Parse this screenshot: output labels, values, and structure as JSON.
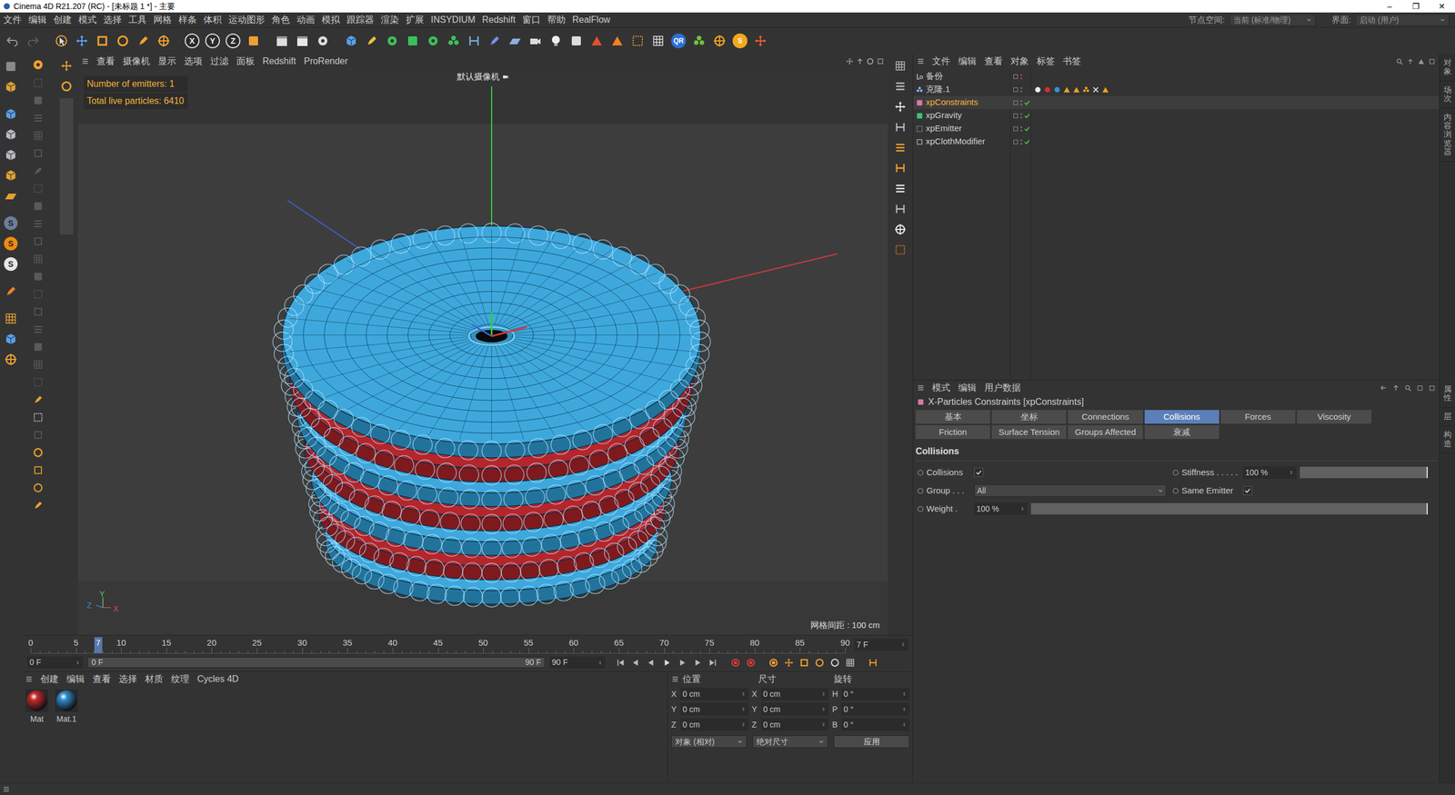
{
  "window": {
    "title": "Cinema 4D R21.207 (RC) - [未标题 1 *] - 主要",
    "controls": [
      "–",
      "❐",
      "✕"
    ]
  },
  "menubar": {
    "items": [
      "文件",
      "编辑",
      "创建",
      "模式",
      "选择",
      "工具",
      "网格",
      "样条",
      "体积",
      "运动图形",
      "角色",
      "动画",
      "模拟",
      "跟踪器",
      "渲染",
      "扩展",
      "INSYDIUM",
      "Redshift",
      "窗口",
      "帮助",
      "RealFlow"
    ],
    "node_space": {
      "label": "节点空间:",
      "value": "当前 (标准/物理)"
    },
    "layout": {
      "label": "界面:",
      "value": "启动 (用户)"
    }
  },
  "toolbar": {
    "axis_keys": [
      "X",
      "Y",
      "Z"
    ],
    "plugins": [
      {
        "label": "QR",
        "color": "#2d6fd6"
      },
      {
        "label": "S",
        "color": "#f2a81d"
      }
    ]
  },
  "left_toolbar": {
    "badges": [
      {
        "label": "S",
        "color": "#6a7f9c"
      },
      {
        "label": "S",
        "color": "#ee8a14"
      },
      {
        "label": "S",
        "color": "#e6e6e6"
      }
    ]
  },
  "viewport": {
    "menu": [
      "查看",
      "摄像机",
      "显示",
      "选项",
      "过滤",
      "面板",
      "Redshift",
      "ProRender"
    ],
    "camera": "默认摄像机",
    "hud": [
      "Number of emitters: 1",
      "Total live particles: 6410"
    ],
    "grid_spacing": "网格间距 : 100 cm",
    "gizmo": [
      {
        "label": "Z",
        "color": "#4a78d8"
      },
      {
        "label": "Y",
        "color": "#5cc85c"
      },
      {
        "label": "X",
        "color": "#d84a4a"
      }
    ]
  },
  "timeline": {
    "ticks": [
      "0",
      "5",
      "10",
      "15",
      "20",
      "25",
      "30",
      "35",
      "40",
      "45",
      "50",
      "55",
      "60",
      "65",
      "70",
      "75",
      "80",
      "85",
      "90"
    ],
    "current_label": "7",
    "current_level": 0.078,
    "current_field": "7 F",
    "start_field": "0 F",
    "range_start": "0 F",
    "range_end": "90 F",
    "end_field": "90 F"
  },
  "materials": {
    "menu": [
      "创建",
      "编辑",
      "查看",
      "选择",
      "材质",
      "纹理",
      "Cycles 4D"
    ],
    "items": [
      {
        "name": "Mat",
        "color": "#c42a2a",
        "selected": false
      },
      {
        "name": "Mat.1",
        "color": "#2e8ccc",
        "selected": false
      }
    ]
  },
  "coordinates": {
    "headers": [
      "位置",
      "尺寸",
      "旋转"
    ],
    "rows": [
      {
        "position": {
          "axis": "X",
          "value": "0 cm"
        },
        "size": {
          "axis": "X",
          "value": "0 cm"
        },
        "rotation": {
          "axis": "H",
          "value": "0 °"
        }
      },
      {
        "position": {
          "axis": "Y",
          "value": "0 cm"
        },
        "size": {
          "axis": "Y",
          "value": "0 cm"
        },
        "rotation": {
          "axis": "P",
          "value": "0 °"
        }
      },
      {
        "position": {
          "axis": "Z",
          "value": "0 cm"
        },
        "size": {
          "axis": "Z",
          "value": "0 cm"
        },
        "rotation": {
          "axis": "B",
          "value": "0 °"
        }
      }
    ],
    "mode": "对象 (相对)",
    "size_mode": "绝对尺寸",
    "apply": "应用"
  },
  "objects": {
    "menu": [
      "文件",
      "编辑",
      "查看",
      "对象",
      "标签",
      "书签"
    ],
    "items": [
      {
        "name": "备份",
        "kind": "null",
        "selected": false,
        "disabled": true,
        "checked": false,
        "tags": []
      },
      {
        "name": "克隆.1",
        "kind": "cloner",
        "selected": false,
        "disabled": false,
        "checked": false,
        "tags": [
          {
            "kind": "sphere",
            "color": "#eeeeee"
          },
          {
            "kind": "sphere",
            "color": "#d03030"
          },
          {
            "kind": "sphere",
            "color": "#3a8fd0"
          },
          {
            "kind": "triangle",
            "color": "#f0a020"
          },
          {
            "kind": "triangle",
            "color": "#f0a020"
          },
          {
            "kind": "dots",
            "color": "#f0a020"
          },
          {
            "kind": "cross",
            "color": "#e0e0e0"
          },
          {
            "kind": "triangle",
            "color": "#f0a020"
          }
        ]
      },
      {
        "name": "xpConstraints",
        "kind": "xp-constraints",
        "selected": true,
        "disabled": false,
        "checked": true,
        "tags": []
      },
      {
        "name": "xpGravity",
        "kind": "xp-gravity",
        "selected": false,
        "disabled": false,
        "checked": true,
        "tags": []
      },
      {
        "name": "xpEmitter",
        "kind": "xp-emitter",
        "selected": false,
        "disabled": false,
        "checked": true,
        "tags": []
      },
      {
        "name": "xpClothModifier",
        "kind": "xp-modifier",
        "selected": false,
        "disabled": false,
        "checked": true,
        "tags": []
      }
    ]
  },
  "attributes": {
    "menu": [
      "模式",
      "编辑",
      "用户数据"
    ],
    "title": "X-Particles Constraints [xpConstraints]",
    "tabs": [
      {
        "label": "基本",
        "selected": false
      },
      {
        "label": "坐标",
        "selected": false
      },
      {
        "label": "Connections",
        "selected": false
      },
      {
        "label": "Collisions",
        "selected": true
      },
      {
        "label": "Forces",
        "selected": false
      },
      {
        "label": "Viscosity",
        "selected": false
      },
      {
        "label": "Friction",
        "selected": false
      },
      {
        "label": "Surface Tension",
        "selected": false
      },
      {
        "label": "Groups Affected",
        "selected": false
      },
      {
        "label": "衰减",
        "selected": false
      }
    ],
    "section": "Collisions",
    "rows": [
      [
        {
          "kind": "checkbox",
          "label": "Collisions",
          "checked": true
        },
        {
          "kind": "slider",
          "label": "Stiffness . . . . .",
          "value": "100 %",
          "level": 1
        }
      ],
      [
        {
          "kind": "dropdown",
          "label": "Group . . .",
          "value": "All"
        },
        {
          "kind": "checkbox",
          "label": "Same Emitter",
          "checked": true
        }
      ],
      [
        {
          "kind": "slider",
          "label": "Weight .",
          "value": "100 %",
          "level": 1
        }
      ]
    ]
  },
  "side_tabs": {
    "top": [
      "对象",
      "场次",
      "内容浏览器"
    ],
    "bottom": [
      "属性",
      "层",
      "构造"
    ]
  }
}
